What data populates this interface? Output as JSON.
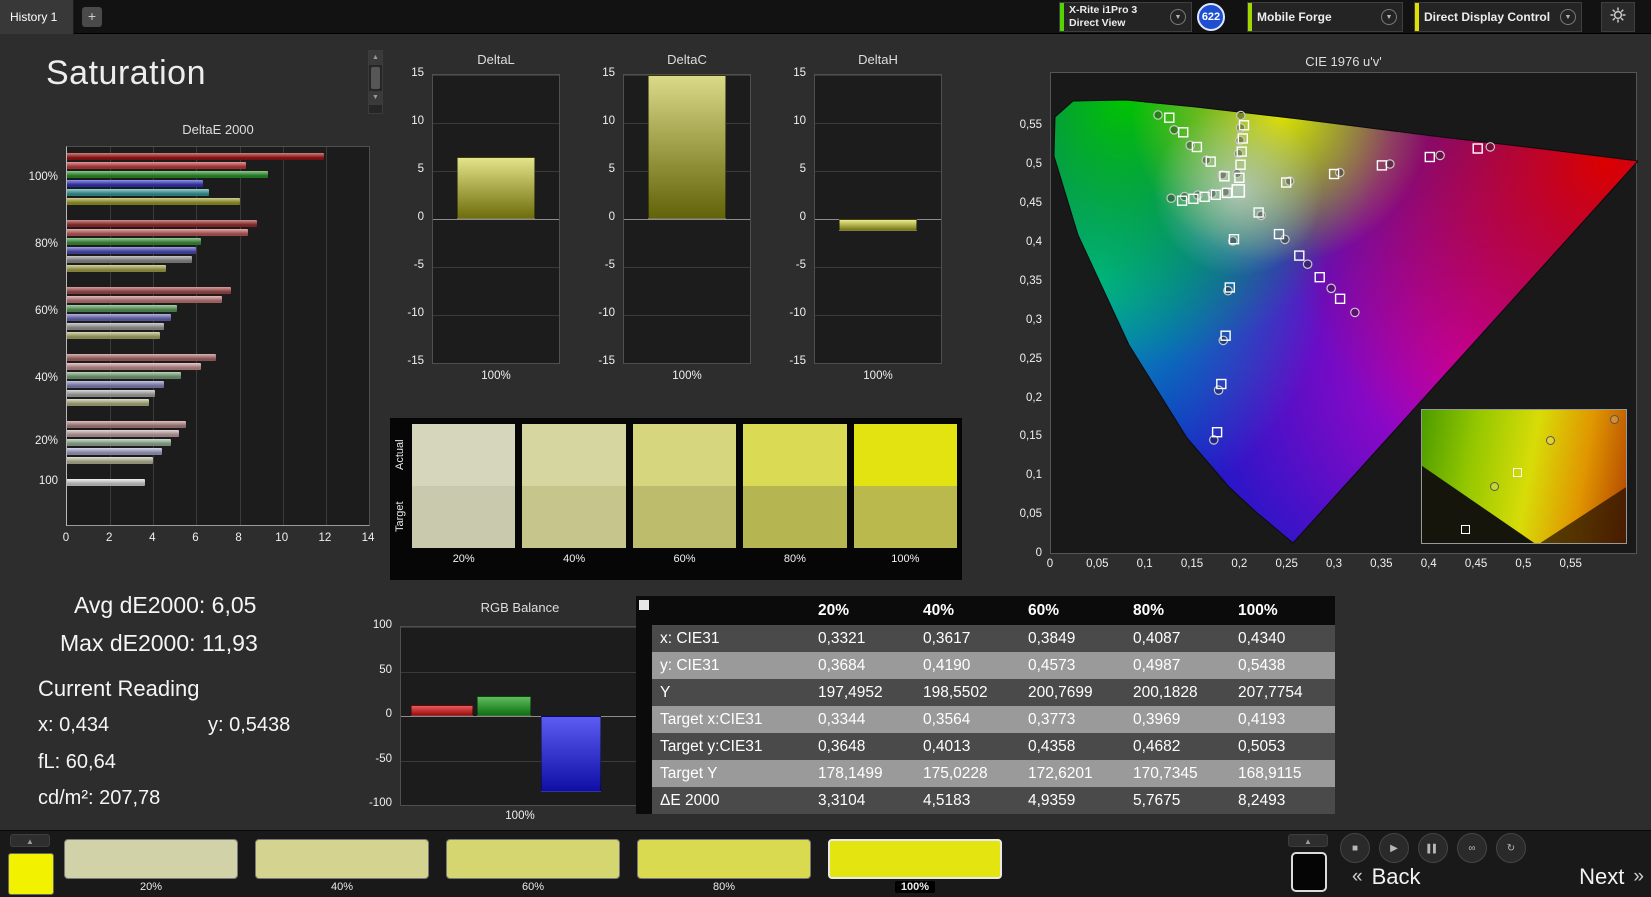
{
  "icons": {
    "chevron_down": "▼",
    "scroll_up": "▲",
    "scroll_down": "▼",
    "panel_up": "▲"
  },
  "top_bar": {
    "history_tab": "History 1",
    "add_tab_label": "+",
    "meter": {
      "line1": "X-Rite i1Pro 3",
      "line2": "Direct View",
      "stripe": "#52d400"
    },
    "badge": "622",
    "source": {
      "label": "Mobile Forge",
      "stripe": "#a0d800"
    },
    "display": {
      "label": "Direct Display Control",
      "stripe": "#e0e000"
    }
  },
  "page_title": "Saturation",
  "stats": {
    "avg": "Avg dE2000: 6,05",
    "max": "Max dE2000: 11,93",
    "current_reading": "Current Reading",
    "x": "x: 0,434",
    "y": "y: 0,5438",
    "fl": "fL: 60,64",
    "cdm2": "cd/m²: 207,78"
  },
  "swatch_compare": {
    "row_labels": [
      "Actual",
      "Target"
    ],
    "columns": [
      {
        "label": "20%",
        "actual": "#d6d6bd",
        "target": "#c9c9ad"
      },
      {
        "label": "40%",
        "actual": "#d6d6a0",
        "target": "#c5c58c"
      },
      {
        "label": "60%",
        "actual": "#d6d67e",
        "target": "#bcbc6c"
      },
      {
        "label": "80%",
        "actual": "#dada55",
        "target": "#b5b551"
      },
      {
        "label": "100%",
        "actual": "#e3e312",
        "target": "#b9b94e"
      }
    ]
  },
  "table": {
    "columns": [
      "20%",
      "40%",
      "60%",
      "80%",
      "100%"
    ],
    "rows": [
      {
        "label": "x: CIE31",
        "values": [
          "0,3321",
          "0,3617",
          "0,3849",
          "0,4087",
          "0,4340"
        ]
      },
      {
        "label": "y: CIE31",
        "values": [
          "0,3684",
          "0,4190",
          "0,4573",
          "0,4987",
          "0,5438"
        ]
      },
      {
        "label": "Y",
        "values": [
          "197,4952",
          "198,5502",
          "200,7699",
          "200,1828",
          "207,7754"
        ]
      },
      {
        "label": "Target x:CIE31",
        "values": [
          "0,3344",
          "0,3564",
          "0,3773",
          "0,3969",
          "0,4193"
        ]
      },
      {
        "label": "Target y:CIE31",
        "values": [
          "0,3648",
          "0,4013",
          "0,4358",
          "0,4682",
          "0,5053"
        ]
      },
      {
        "label": "Target Y",
        "values": [
          "178,1499",
          "175,0228",
          "172,6201",
          "170,7345",
          "168,9115"
        ]
      },
      {
        "label": "ΔE 2000",
        "values": [
          "3,3104",
          "4,5183",
          "4,9359",
          "5,7675",
          "8,2493"
        ]
      }
    ]
  },
  "bottom_bar": {
    "current_color": "#f2f200",
    "swatches": [
      {
        "label": "20%",
        "color": "#d2d2a8",
        "selected": false
      },
      {
        "label": "40%",
        "color": "#d4d490",
        "selected": false
      },
      {
        "label": "60%",
        "color": "#d6d670",
        "selected": false
      },
      {
        "label": "80%",
        "color": "#dada50",
        "selected": false
      },
      {
        "label": "100%",
        "color": "#e4e410",
        "selected": true
      }
    ],
    "transport": [
      {
        "name": "stop",
        "glyph": "■"
      },
      {
        "name": "play",
        "glyph": "▶"
      },
      {
        "name": "pause",
        "glyph": "▌▌"
      },
      {
        "name": "loop",
        "glyph": "∞"
      },
      {
        "name": "refresh",
        "glyph": "↻"
      }
    ],
    "back_chevron": "«",
    "back_label": "Back",
    "next_label": "Next",
    "next_chevron": "»"
  },
  "chart_data": [
    {
      "id": "deltae2000",
      "type": "bar",
      "orientation": "horizontal",
      "title": "DeltaE 2000",
      "xlim": [
        0,
        14
      ],
      "xticks": [
        0,
        2,
        4,
        6,
        8,
        10,
        12,
        14
      ],
      "groups": [
        {
          "label": "100%",
          "bars": [
            {
              "color": "#a81616",
              "value": 11.93
            },
            {
              "color": "#cf4040",
              "value": 8.3
            },
            {
              "color": "#2f9e2f",
              "value": 9.3
            },
            {
              "color": "#3a3ace",
              "value": 6.3
            },
            {
              "color": "#3fa8a8",
              "value": 6.6
            },
            {
              "color": "#a8a82e",
              "value": 8.0
            }
          ]
        },
        {
          "label": "80%",
          "bars": [
            {
              "color": "#a83232",
              "value": 8.8
            },
            {
              "color": "#d06464",
              "value": 8.4
            },
            {
              "color": "#3f9e3f",
              "value": 6.2
            },
            {
              "color": "#5252c8",
              "value": 6.0
            },
            {
              "color": "#9a9a9a",
              "value": 5.8
            },
            {
              "color": "#b2b252",
              "value": 4.6
            }
          ]
        },
        {
          "label": "60%",
          "bars": [
            {
              "color": "#b05252",
              "value": 7.6
            },
            {
              "color": "#d28484",
              "value": 7.2
            },
            {
              "color": "#62a862",
              "value": 5.1
            },
            {
              "color": "#7272c8",
              "value": 4.8
            },
            {
              "color": "#a8a8a8",
              "value": 4.5
            },
            {
              "color": "#baba72",
              "value": 4.3
            }
          ]
        },
        {
          "label": "40%",
          "bars": [
            {
              "color": "#b87272",
              "value": 6.9
            },
            {
              "color": "#d49c9c",
              "value": 6.2
            },
            {
              "color": "#82b082",
              "value": 5.3
            },
            {
              "color": "#9292cc",
              "value": 4.5
            },
            {
              "color": "#b8b8b8",
              "value": 4.1
            },
            {
              "color": "#c2c292",
              "value": 3.8
            }
          ]
        },
        {
          "label": "20%",
          "bars": [
            {
              "color": "#c09090",
              "value": 5.5
            },
            {
              "color": "#d2b2b2",
              "value": 5.2
            },
            {
              "color": "#a2c0a2",
              "value": 4.8
            },
            {
              "color": "#b0b0d8",
              "value": 4.4
            },
            {
              "color": "#c8c8a8",
              "value": 4.0
            }
          ]
        },
        {
          "label": "100",
          "bars": [
            {
              "color": "#e4e4e4",
              "value": 3.6
            }
          ]
        }
      ]
    },
    {
      "id": "deltal",
      "type": "bar",
      "title": "DeltaL",
      "ylim": [
        -15,
        15
      ],
      "yticks": [
        15,
        10,
        5,
        0,
        -5,
        -10,
        -15
      ],
      "categories": [
        "100%"
      ],
      "values": [
        6.5
      ],
      "bar_color": "#c8c814"
    },
    {
      "id": "deltac",
      "type": "bar",
      "title": "DeltaC",
      "ylim": [
        -15,
        15
      ],
      "yticks": [
        15,
        10,
        5,
        0,
        -5,
        -10,
        -15
      ],
      "categories": [
        "100%"
      ],
      "values": [
        15
      ],
      "bar_color": "#b4b410"
    },
    {
      "id": "deltah",
      "type": "bar",
      "title": "DeltaH",
      "ylim": [
        -15,
        15
      ],
      "yticks": [
        15,
        10,
        5,
        0,
        -5,
        -10,
        -15
      ],
      "categories": [
        "100%"
      ],
      "values": [
        -1.2
      ],
      "bar_color": "#d8d820"
    },
    {
      "id": "rgb_balance",
      "type": "bar",
      "title": "RGB Balance",
      "ylim": [
        -100,
        100
      ],
      "yticks": [
        100,
        50,
        0,
        -50,
        -100
      ],
      "categories": [
        "100%"
      ],
      "series": [
        {
          "name": "red",
          "color": "#e01414",
          "value": 12
        },
        {
          "name": "green",
          "color": "#18a018",
          "value": 22
        },
        {
          "name": "blue",
          "color": "#1616ee",
          "value": -85
        }
      ]
    },
    {
      "id": "cie",
      "type": "scatter",
      "title": "CIE 1976 u'v'",
      "scale_max": 0.62,
      "xticks": [
        {
          "label": "0",
          "value": 0
        },
        {
          "label": "0,05",
          "value": 0.05
        },
        {
          "label": "0,1",
          "value": 0.1
        },
        {
          "label": "0,15",
          "value": 0.15
        },
        {
          "label": "0,2",
          "value": 0.2
        },
        {
          "label": "0,25",
          "value": 0.25
        },
        {
          "label": "0,3",
          "value": 0.3
        },
        {
          "label": "0,35",
          "value": 0.35
        },
        {
          "label": "0,4",
          "value": 0.4
        },
        {
          "label": "0,45",
          "value": 0.45
        },
        {
          "label": "0,5",
          "value": 0.5
        },
        {
          "label": "0,55",
          "value": 0.55
        }
      ],
      "yticks": [
        {
          "label": "0",
          "value": 0
        },
        {
          "label": "0,05",
          "value": 0.05
        },
        {
          "label": "0,1",
          "value": 0.1
        },
        {
          "label": "0,15",
          "value": 0.15
        },
        {
          "label": "0,2",
          "value": 0.2
        },
        {
          "label": "0,25",
          "value": 0.25
        },
        {
          "label": "0,3",
          "value": 0.3
        },
        {
          "label": "0,35",
          "value": 0.35
        },
        {
          "label": "0,4",
          "value": 0.4
        },
        {
          "label": "0,45",
          "value": 0.45
        },
        {
          "label": "0,5",
          "value": 0.5
        },
        {
          "label": "0,55",
          "value": 0.55
        }
      ],
      "white_point": [
        0.1978,
        0.4683
      ],
      "targets": [
        [
          0.2484,
          0.4792
        ],
        [
          0.299,
          0.4901
        ],
        [
          0.3495,
          0.5011
        ],
        [
          0.4001,
          0.512
        ],
        [
          0.4507,
          0.5229
        ],
        [
          0.1832,
          0.4871
        ],
        [
          0.1687,
          0.506
        ],
        [
          0.1541,
          0.5248
        ],
        [
          0.1396,
          0.5437
        ],
        [
          0.125,
          0.5625
        ],
        [
          0.1933,
          0.4062
        ],
        [
          0.1888,
          0.3441
        ],
        [
          0.1844,
          0.2821
        ],
        [
          0.1799,
          0.22
        ],
        [
          0.1754,
          0.1579
        ],
        [
          0.1859,
          0.4658
        ],
        [
          0.1741,
          0.4633
        ],
        [
          0.1622,
          0.4607
        ],
        [
          0.1504,
          0.4582
        ],
        [
          0.1385,
          0.4557
        ],
        [
          0.2193,
          0.4406
        ],
        [
          0.2408,
          0.4128
        ],
        [
          0.2623,
          0.3851
        ],
        [
          0.2838,
          0.3573
        ],
        [
          0.3053,
          0.3296
        ],
        [
          0.199,
          0.4852
        ],
        [
          0.2002,
          0.5021
        ],
        [
          0.2014,
          0.5189
        ],
        [
          0.2026,
          0.5358
        ],
        [
          0.2038,
          0.5527
        ]
      ],
      "measurements": [
        [
          0.252,
          0.481
        ],
        [
          0.305,
          0.492
        ],
        [
          0.358,
          0.503
        ],
        [
          0.411,
          0.514
        ],
        [
          0.464,
          0.525
        ],
        [
          0.181,
          0.489
        ],
        [
          0.164,
          0.508
        ],
        [
          0.147,
          0.527
        ],
        [
          0.13,
          0.547
        ],
        [
          0.113,
          0.566
        ],
        [
          0.192,
          0.404
        ],
        [
          0.187,
          0.34
        ],
        [
          0.182,
          0.276
        ],
        [
          0.177,
          0.212
        ],
        [
          0.172,
          0.148
        ],
        [
          0.184,
          0.467
        ],
        [
          0.17,
          0.465
        ],
        [
          0.155,
          0.463
        ],
        [
          0.141,
          0.461
        ],
        [
          0.127,
          0.459
        ],
        [
          0.222,
          0.437
        ],
        [
          0.247,
          0.406
        ],
        [
          0.271,
          0.374
        ],
        [
          0.296,
          0.343
        ],
        [
          0.321,
          0.312
        ],
        [
          0.1966,
          0.4907
        ],
        [
          0.1981,
          0.5163
        ],
        [
          0.1995,
          0.5333
        ],
        [
          0.2002,
          0.5495
        ],
        [
          0.2005,
          0.5653
        ]
      ],
      "inset": {
        "squares": [
          [
            0.21,
            0.88
          ],
          [
            0.46,
            0.46
          ]
        ],
        "circles": [
          [
            0.35,
            0.56
          ],
          [
            0.62,
            0.22
          ],
          [
            0.93,
            0.07
          ]
        ]
      }
    }
  ]
}
